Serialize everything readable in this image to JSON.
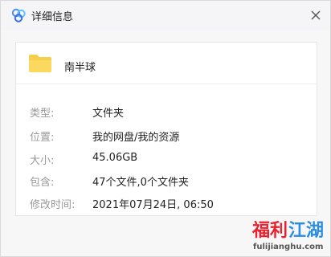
{
  "window": {
    "title": "详细信息",
    "icon": "baidu-netdisk-cloud-icon",
    "close_icon": "close-icon"
  },
  "file": {
    "name": "南半球",
    "icon": "folder-icon",
    "icon_color": "#f6cf4a"
  },
  "details": [
    {
      "label": "类型:",
      "value": "文件夹"
    },
    {
      "label": "位置:",
      "value": "我的网盘/我的资源"
    },
    {
      "label": "大小:",
      "value": "45.06GB"
    },
    {
      "label": "包含:",
      "value": "47个文件,0个文件夹"
    },
    {
      "label": "修改时间:",
      "value": "2021年07月24日, 06:50"
    }
  ],
  "watermark": {
    "text_main": "福利江湖",
    "text_sub": "fulijianghu.com",
    "color_red": "#e8222e",
    "color_blue": "#2a8de0"
  }
}
